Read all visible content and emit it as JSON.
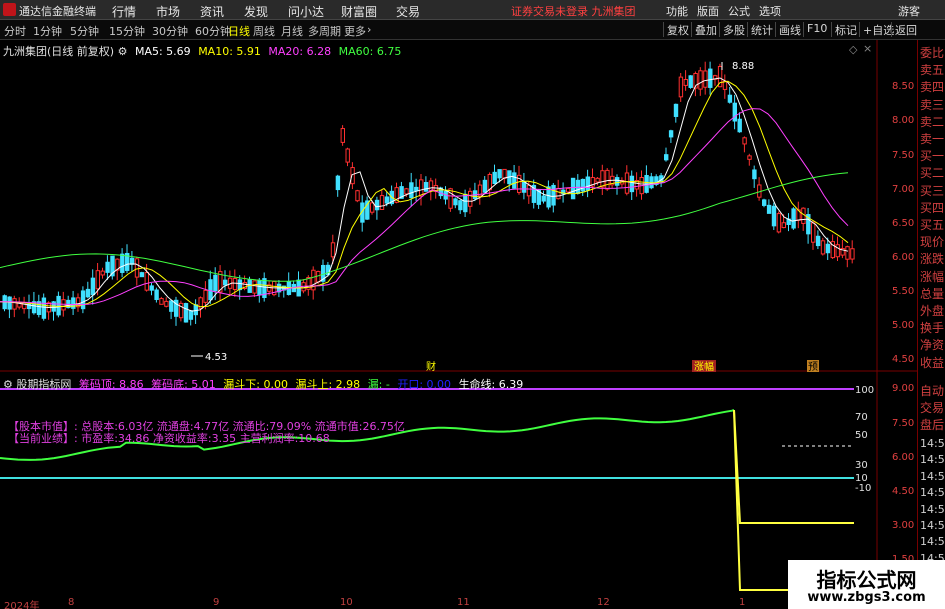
{
  "menubar": {
    "app_title": "通达信金融终端",
    "menus": [
      "行情",
      "市场",
      "资讯",
      "发现",
      "问小达",
      "财富圈",
      "交易"
    ],
    "warning": "证券交易未登录  九洲集团",
    "right_menus": [
      "功能",
      "版面",
      "公式",
      "选项"
    ],
    "guest": "游客"
  },
  "toolbar": {
    "periods": [
      "分时",
      "1分钟",
      "5分钟",
      "15分钟",
      "30分钟",
      "60分钟",
      "日线",
      "周线",
      "月线",
      "多周期",
      "更多"
    ],
    "active_period": "日线",
    "right_buttons": [
      "复权",
      "叠加",
      "多股",
      "统计",
      "画线",
      "F10",
      "标记",
      "+自选",
      "返回"
    ]
  },
  "main_chart": {
    "stock_title": "九洲集团(日线 前复权)",
    "ma": [
      {
        "label": "MA5: 5.69",
        "color": "#ffffff"
      },
      {
        "label": "MA10: 5.91",
        "color": "#ffff00"
      },
      {
        "label": "MA20: 6.28",
        "color": "#ff40ff"
      },
      {
        "label": "MA60: 6.75",
        "color": "#40ff40"
      }
    ],
    "high_label": "8.88",
    "low_label": "4.53",
    "price_ticks": [
      "8.50",
      "8.00",
      "7.50",
      "7.00",
      "6.50",
      "6.00",
      "5.50",
      "5.00",
      "4.50"
    ],
    "event_markers": [
      "财",
      "涨幅",
      "预"
    ]
  },
  "indicator": {
    "name": "股期指标网",
    "fields": [
      {
        "label": "筹码顶: 8.86",
        "color": "#ff40ff"
      },
      {
        "label": "筹码底: 5.01",
        "color": "#ff40ff"
      },
      {
        "label": "漏斗下: 0.00",
        "color": "#ffff00"
      },
      {
        "label": "漏斗上: 2.98",
        "color": "#ffff00"
      },
      {
        "label": "漏: -",
        "color": "#40ff40"
      },
      {
        "label": "开口: 0.00",
        "color": "#2020ff"
      },
      {
        "label": "生命线: 6.39",
        "color": "#ffffff"
      }
    ],
    "info_line1": "【股本市值】: 总股本:6.03亿 流通盘:4.77亿 流通比:79.09% 流通市值:26.75亿",
    "info_line2": "【当前业绩】: 市盈率:34.86 净资收益率:3.35 主营利润率:10.68",
    "left_ticks": [
      "100",
      "70",
      "50",
      "30",
      "10",
      "0",
      "-10"
    ],
    "right_ticks": [
      "9.00",
      "7.50",
      "6.00",
      "4.50",
      "3.00",
      "1.50"
    ]
  },
  "right_panel": {
    "items": [
      "委比",
      "卖五",
      "卖四",
      "卖三",
      "卖二",
      "卖一",
      "买一",
      "买二",
      "买三",
      "买四",
      "买五",
      "现价",
      "涨跌",
      "涨幅",
      "总量",
      "外盘",
      "换手",
      "净资",
      "收益",
      "自动",
      "交易",
      "盘后"
    ],
    "times": [
      "14:56",
      "14:56",
      "14:56",
      "14:56",
      "14:56",
      "14:56",
      "14:56",
      "14:56",
      "14:56"
    ]
  },
  "date_axis": [
    "2024年",
    "8",
    "9",
    "10",
    "11",
    "12",
    "1"
  ],
  "watermark": {
    "main": "指标公式网",
    "sub": "www.zbgs3.com"
  }
}
